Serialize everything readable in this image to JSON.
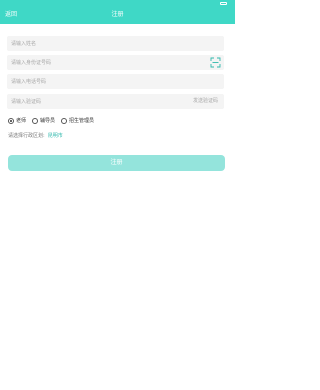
{
  "colors": {
    "accent": "#3fd8c6",
    "button": "#94e4dc",
    "field_bg": "#f4f4f4",
    "link": "#2fb8ac"
  },
  "nav": {
    "back_label": "返回",
    "title": "注册"
  },
  "form": {
    "name_placeholder": "请输入姓名",
    "id_card_placeholder": "请输入身份证号码",
    "phone_placeholder": "请输入电话号码",
    "code_placeholder": "请输入验证码",
    "send_code_label": "发送验证码",
    "roles": [
      {
        "label": "老师",
        "checked": true
      },
      {
        "label": "辅导员",
        "checked": false
      },
      {
        "label": "招生管理员",
        "checked": false
      }
    ],
    "region_label": "请选择行政区划:",
    "region_value": "昆明市",
    "submit_label": "注册"
  },
  "icons": {
    "scan": "scan-icon",
    "battery": "battery-icon"
  }
}
